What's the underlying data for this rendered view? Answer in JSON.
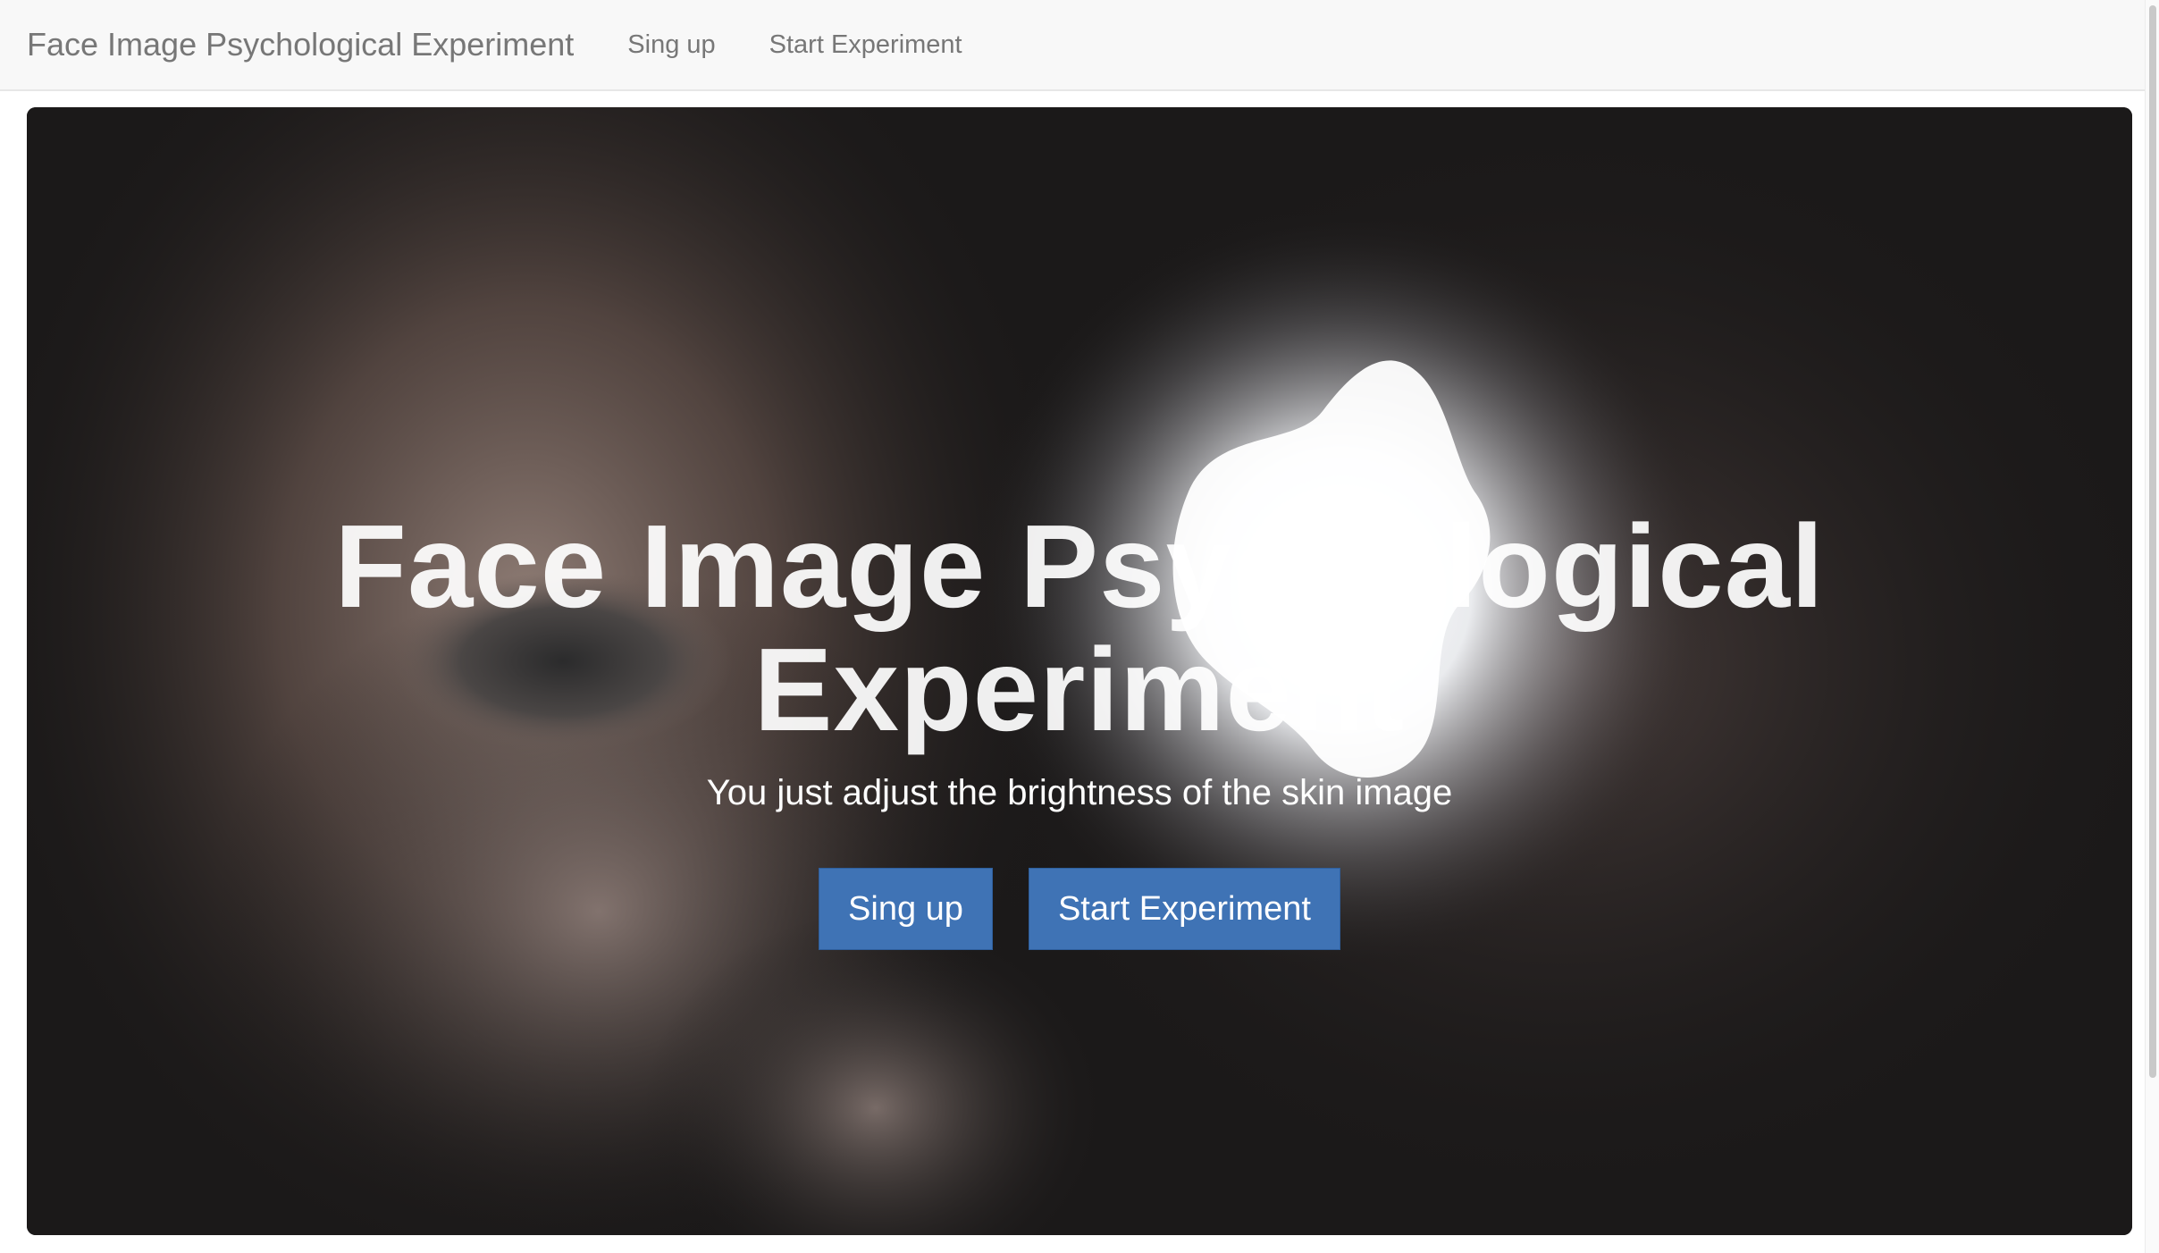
{
  "navbar": {
    "brand": "Face Image Psychological Experiment",
    "links": [
      {
        "label": "Sing up"
      },
      {
        "label": "Start Experiment"
      }
    ]
  },
  "hero": {
    "title": "Face Image Psychological Experiment",
    "subtitle": "You just adjust the brightness of the skin image",
    "buttons": [
      {
        "label": "Sing up"
      },
      {
        "label": "Start Experiment"
      }
    ],
    "background_image": "close-up-face-eye-peering-through-bright-hole-photo"
  },
  "colors": {
    "navbar_bg": "#f8f8f8",
    "nav_text": "#777777",
    "hero_bg": "#1b1919",
    "button_primary": "#3f73b5",
    "hero_text": "#ffffff"
  }
}
